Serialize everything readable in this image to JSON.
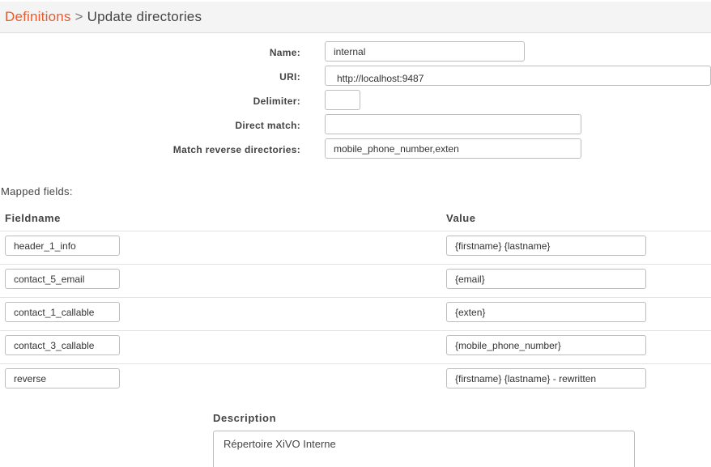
{
  "breadcrumb": {
    "parent": "Definitions",
    "separator": ">",
    "current": "Update directories"
  },
  "form": {
    "name": {
      "label": "Name:",
      "value": "internal"
    },
    "uri": {
      "label": "URI:",
      "value": "http://localhost:9487"
    },
    "delimiter": {
      "label": "Delimiter:",
      "value": ""
    },
    "direct_match": {
      "label": "Direct match:",
      "value": ""
    },
    "match_reverse": {
      "label": "Match reverse directories:",
      "value": "mobile_phone_number,exten"
    }
  },
  "mapped_fields": {
    "label": "Mapped fields:",
    "headers": {
      "fieldname": "Fieldname",
      "value": "Value"
    },
    "rows": [
      {
        "fieldname": "header_1_info",
        "value": "{firstname} {lastname}"
      },
      {
        "fieldname": "contact_5_email",
        "value": "{email}"
      },
      {
        "fieldname": "contact_1_callable",
        "value": "{exten}"
      },
      {
        "fieldname": "contact_3_callable",
        "value": "{mobile_phone_number}"
      },
      {
        "fieldname": "reverse",
        "value": "{firstname} {lastname} - rewritten"
      }
    ]
  },
  "description": {
    "label": "Description",
    "value": "Répertoire XiVO Interne"
  },
  "colors": {
    "accent": "#e75b2d",
    "header_bg": "#f4f4f4",
    "text": "#444444",
    "border": "#bdbdbd"
  }
}
